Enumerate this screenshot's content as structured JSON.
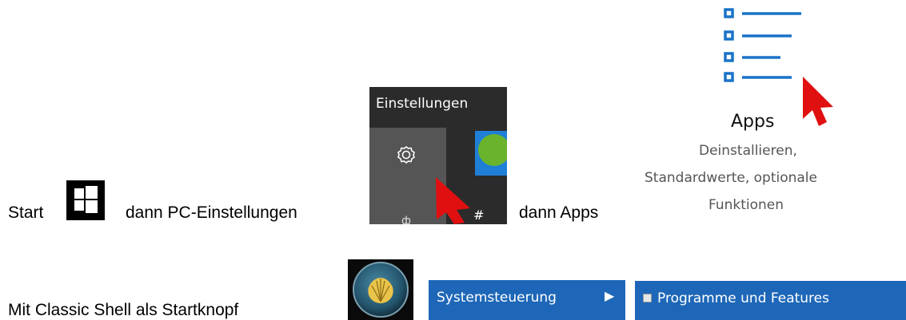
{
  "row1": {
    "start_label": "Start",
    "then_pc_settings": "dann PC-Einstellungen",
    "then_apps": "dann Apps"
  },
  "settings_tooltip": "Einstellungen",
  "apps_panel": {
    "title": "Apps",
    "desc_line1": "Deinstallieren,",
    "desc_line2": "Standardwerte, optionale",
    "desc_line3": "Funktionen"
  },
  "row2": {
    "classic_shell_label": "Mit Classic Shell als Startknopf"
  },
  "menu": {
    "control_panel": "Systemsteuerung",
    "submenu_arrow": "▶",
    "programs_features": "Programme und Features"
  },
  "colors": {
    "accent_blue": "#1e67b8",
    "apps_icon_blue": "#1a73c8",
    "cursor_red": "#e01010"
  },
  "icons": [
    "windows-logo-icon",
    "gear-icon",
    "utorrent-icon",
    "apps-list-icon",
    "red-arrow-cursor-icon",
    "classic-shell-icon",
    "submenu-arrow-icon",
    "programs-icon"
  ]
}
